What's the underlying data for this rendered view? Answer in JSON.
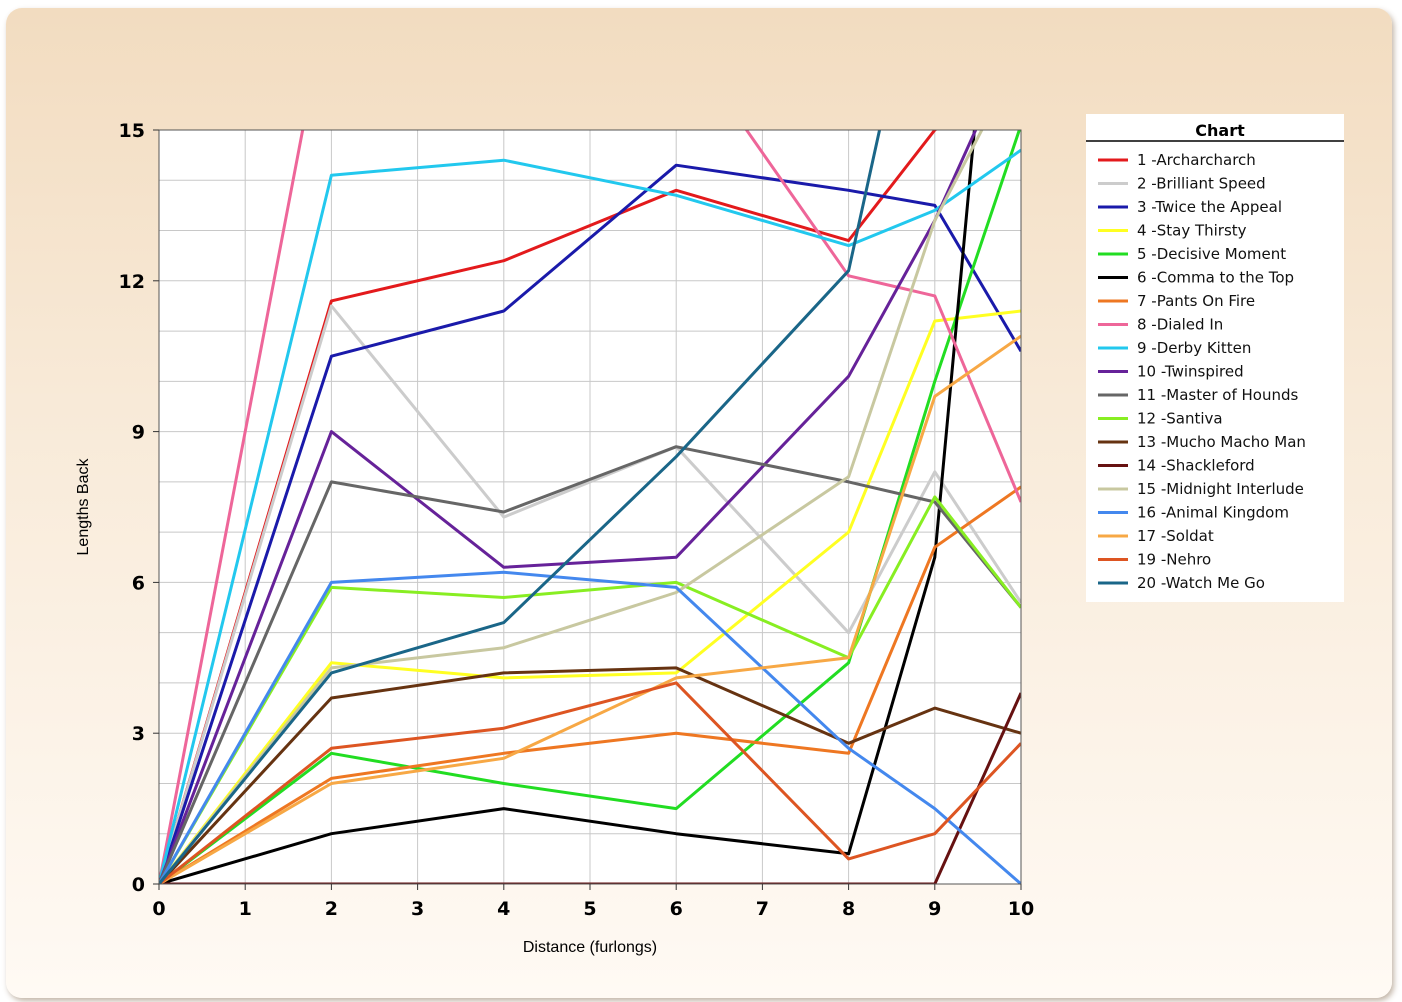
{
  "chart_data": {
    "type": "line",
    "xlabel": "Distance (furlongs)",
    "ylabel": "Lengths Back",
    "xlim": [
      0,
      10
    ],
    "ylim": [
      0,
      15
    ],
    "xticks": [
      0,
      1,
      2,
      3,
      4,
      5,
      6,
      7,
      8,
      9,
      10
    ],
    "yticks": [
      0,
      3,
      6,
      9,
      12,
      15
    ],
    "grid": true,
    "legend_title": "Chart",
    "legend_position": "right",
    "x": [
      0,
      2,
      4,
      6,
      8,
      9,
      10
    ],
    "series": [
      {
        "name": "1 -Archarcharch",
        "color": "#e31a1c",
        "values": [
          0,
          11.6,
          12.4,
          13.8,
          12.8,
          15.0,
          16.0
        ]
      },
      {
        "name": "2 -Brilliant Speed",
        "color": "#cccccc",
        "values": [
          0,
          11.5,
          7.3,
          8.7,
          5.0,
          8.2,
          5.6
        ]
      },
      {
        "name": "3 -Twice the Appeal",
        "color": "#1a1aaa",
        "values": [
          0,
          10.5,
          11.4,
          14.3,
          13.8,
          13.5,
          10.6
        ]
      },
      {
        "name": "4 -Stay Thirsty",
        "color": "#ffff22",
        "values": [
          0,
          4.4,
          4.1,
          4.2,
          7.0,
          11.2,
          11.4
        ]
      },
      {
        "name": "5 -Decisive Moment",
        "color": "#22dd22",
        "values": [
          0,
          2.6,
          2.0,
          1.5,
          4.4,
          10.0,
          15.1
        ]
      },
      {
        "name": "6 -Comma to the Top",
        "color": "#000000",
        "values": [
          0,
          1.0,
          1.5,
          1.0,
          0.6,
          6.5,
          25.0
        ]
      },
      {
        "name": "7 -Pants On Fire",
        "color": "#ee7722",
        "values": [
          0,
          2.1,
          2.6,
          3.0,
          2.6,
          6.7,
          7.9
        ]
      },
      {
        "name": "8 -Dialed In",
        "color": "#ee6699",
        "values": [
          0,
          18.0,
          20.0,
          17.0,
          12.1,
          11.7,
          7.6
        ]
      },
      {
        "name": "9 -Derby Kitten",
        "color": "#22c8ee",
        "values": [
          0,
          14.1,
          14.4,
          13.7,
          12.7,
          13.4,
          14.6
        ]
      },
      {
        "name": "10 -Twinspired",
        "color": "#662299",
        "values": [
          0,
          9.0,
          6.3,
          6.5,
          10.1,
          13.2,
          17.0
        ]
      },
      {
        "name": "11 -Master of Hounds",
        "color": "#666666",
        "values": [
          0,
          8.0,
          7.4,
          8.7,
          8.0,
          7.6,
          5.5
        ]
      },
      {
        "name": "12 -Santiva",
        "color": "#88ee22",
        "values": [
          0,
          5.9,
          5.7,
          6.0,
          4.5,
          7.7,
          5.5
        ]
      },
      {
        "name": "13 -Mucho Macho Man",
        "color": "#663311",
        "values": [
          0,
          3.7,
          4.2,
          4.3,
          2.8,
          3.5,
          3.0
        ]
      },
      {
        "name": "14 -Shackleford",
        "color": "#661111",
        "values": [
          0,
          0,
          0,
          0,
          0,
          0,
          3.8
        ]
      },
      {
        "name": "15 -Midnight Interlude",
        "color": "#c8c8a0",
        "values": [
          0,
          4.3,
          4.7,
          5.8,
          8.1,
          13.2,
          16.5
        ]
      },
      {
        "name": "16 -Animal Kingdom",
        "color": "#4488ee",
        "values": [
          0,
          6.0,
          6.2,
          5.9,
          2.7,
          1.5,
          0
        ]
      },
      {
        "name": "17 -Soldat",
        "color": "#f7a845",
        "values": [
          0,
          2.0,
          2.5,
          4.1,
          4.5,
          9.7,
          10.9
        ]
      },
      {
        "name": "19 -Nehro",
        "color": "#dd5522",
        "values": [
          0,
          2.7,
          3.1,
          4.0,
          0.5,
          1.0,
          2.8
        ]
      },
      {
        "name": "20 -Watch Me Go",
        "color": "#1a6688",
        "values": [
          0,
          4.2,
          5.2,
          8.5,
          12.2,
          20.0,
          22.0
        ]
      }
    ]
  }
}
